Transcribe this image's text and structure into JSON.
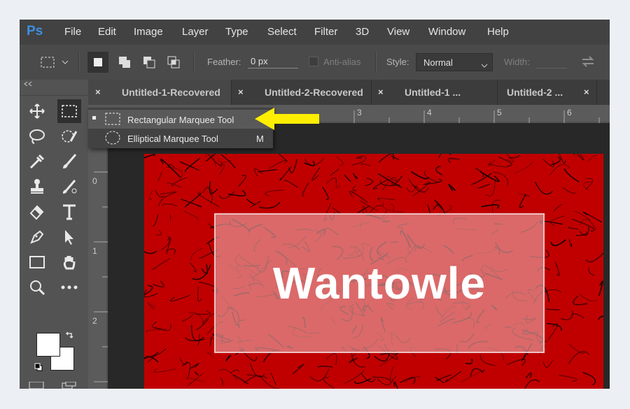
{
  "app": {
    "logo": "Ps"
  },
  "menu": [
    "File",
    "Edit",
    "Image",
    "Layer",
    "Type",
    "Select",
    "Filter",
    "3D",
    "View",
    "Window",
    "Help"
  ],
  "options_bar": {
    "feather_label": "Feather:",
    "feather_value": "0 px",
    "anti_alias_label": "Anti-alias",
    "style_label": "Style:",
    "style_value": "Normal",
    "width_label": "Width:",
    "width_value": ""
  },
  "tabs": [
    {
      "label": "Untitled-1-Recovered"
    },
    {
      "label": "Untitled-2-Recovered"
    },
    {
      "label": "Untitled-1 ..."
    },
    {
      "label": "Untitled-2 ..."
    }
  ],
  "tab_close_glyph": "×",
  "flyout": {
    "items": [
      {
        "label": "Rectangular Marquee Tool",
        "shortcut": "",
        "active": true
      },
      {
        "label": "Elliptical Marquee Tool",
        "shortcut": "M",
        "active": false
      }
    ]
  },
  "ruler_top": [
    "3",
    "4",
    "5",
    "6"
  ],
  "ruler_left": [
    "0",
    "1",
    "2"
  ],
  "canvas": {
    "text": "Wantowle"
  },
  "colors": {
    "arrow": "#ffee00",
    "ps_blue": "#3d8fe0",
    "doc_red": "#c00000"
  },
  "icons": [
    "move-icon",
    "marquee-icon",
    "lasso-icon",
    "quick-selection-icon",
    "eyedropper-icon",
    "brush-icon",
    "stamp-icon",
    "history-brush-icon",
    "eraser-icon",
    "type-icon",
    "pen-icon",
    "path-selection-icon",
    "rectangle-icon",
    "hand-icon",
    "zoom-icon",
    "more-icon"
  ]
}
